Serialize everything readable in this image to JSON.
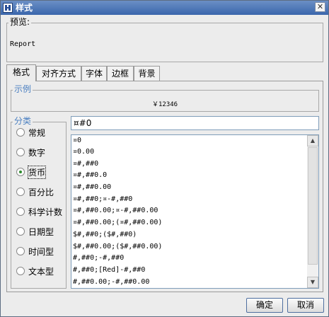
{
  "window": {
    "title": "样式",
    "close_glyph": "✕"
  },
  "preview": {
    "legend": "预览:",
    "text": "Report"
  },
  "tabs": [
    "格式",
    "对齐方式",
    "字体",
    "边框",
    "背景"
  ],
  "sample": {
    "legend": "示例",
    "value": "￥12346"
  },
  "category": {
    "legend": "分类",
    "items": [
      "常规",
      "数字",
      "货币",
      "百分比",
      "科学计数",
      "日期型",
      "时间型",
      "文本型"
    ],
    "selected": "货币"
  },
  "format_input": {
    "value": "¤#0"
  },
  "format_list": [
    "¤0",
    "¤0.00",
    "¤#,##0",
    "¤#,##0.0",
    "¤#,##0.00",
    "¤#,##0;¤-#,##0",
    "¤#,##0.00;¤-#,##0.00",
    "¤#,##0.00;(¤#,##0.00)",
    "$#,##0;($#,##0)",
    "$#,##0.00;($#,##0.00)",
    "#,##0;-#,##0",
    "#,##0;[Red]-#,##0",
    "#,##0.00;-#,##0.00"
  ],
  "buttons": {
    "ok": "确定",
    "cancel": "取消"
  }
}
